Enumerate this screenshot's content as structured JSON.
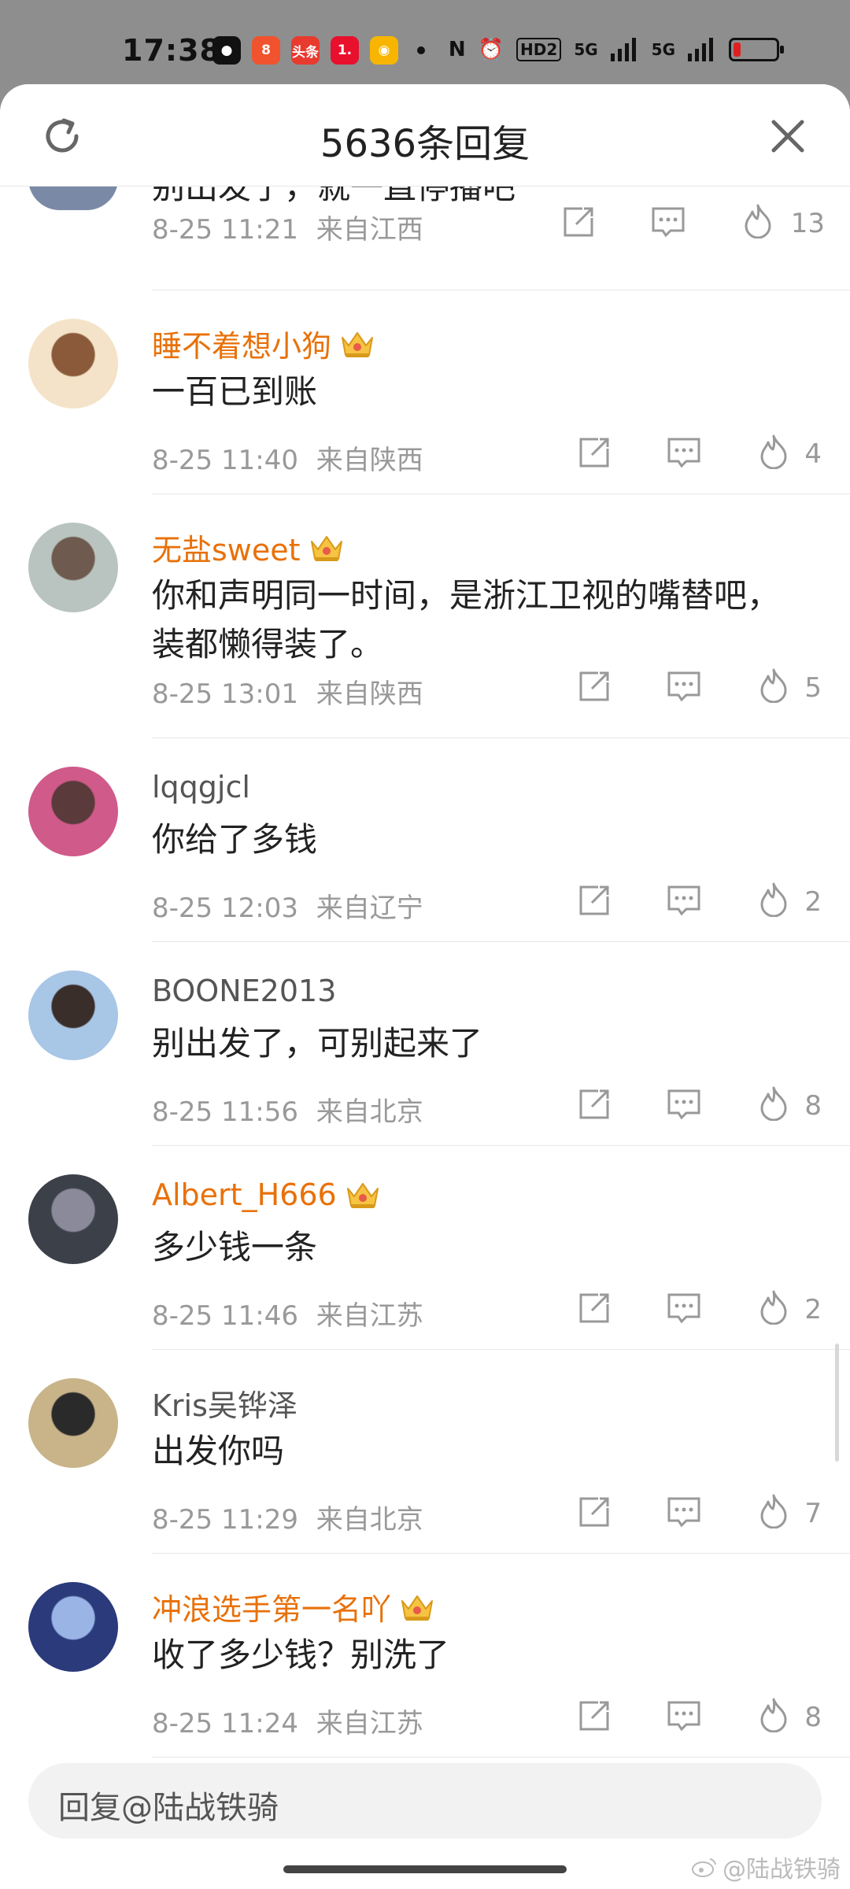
{
  "status_bar": {
    "time": "17:38",
    "apps": [
      {
        "icon": "wechat-icon",
        "color": "#111111",
        "glyph": "●"
      },
      {
        "icon": "app-8-icon",
        "color": "#f0532d",
        "glyph": "8"
      },
      {
        "icon": "toutiao-icon",
        "color": "#e83a2f",
        "glyph": "头条"
      },
      {
        "icon": "app-1-icon",
        "color": "#e8102c",
        "glyph": "1."
      },
      {
        "icon": "weibo-icon",
        "color": "#f7b500",
        "glyph": "◉"
      }
    ],
    "network": [
      "N",
      "⏰",
      "HD2",
      "5G",
      "5G"
    ],
    "battery_level": 0.15
  },
  "header": {
    "title": "5636条回复"
  },
  "partial_comment": {
    "text": "别出发了，就一直停播吧",
    "time": "8-25 11:21",
    "location": "来自江西",
    "likes": "13"
  },
  "comments": [
    {
      "username": "睡不着想小狗",
      "vip": true,
      "text": "一百已到账",
      "time": "8-25 11:40",
      "location": "来自陕西",
      "likes": "4",
      "avatar_colors": [
        "#f4e3c8",
        "#8a5a3a"
      ]
    },
    {
      "username": "无盐sweet",
      "vip": true,
      "text": "你和声明同一时间，是浙江卫视的嘴替吧，装都懒得装了。",
      "time": "8-25 13:01",
      "location": "来自陕西",
      "likes": "5",
      "avatar_colors": [
        "#b9c4c0",
        "#6e5a4e"
      ]
    },
    {
      "username": "lqqgjcl",
      "vip": false,
      "text": "你给了多钱",
      "time": "8-25 12:03",
      "location": "来自辽宁",
      "likes": "2",
      "avatar_colors": [
        "#d05a8a",
        "#5a3a3a"
      ]
    },
    {
      "username": "BOONE2013",
      "vip": false,
      "text": "别出发了，可别起来了",
      "time": "8-25 11:56",
      "location": "来自北京",
      "likes": "8",
      "avatar_colors": [
        "#a8c6e6",
        "#3a2e2a"
      ]
    },
    {
      "username": "Albert_H666",
      "vip": true,
      "text": "多少钱一条",
      "time": "8-25 11:46",
      "location": "来自江苏",
      "likes": "2",
      "avatar_colors": [
        "#3c4048",
        "#8a8a9a"
      ]
    },
    {
      "username": "Kris吴铧泽",
      "vip": false,
      "text": "出发你吗",
      "time": "8-25 11:29",
      "location": "来自北京",
      "likes": "7",
      "avatar_colors": [
        "#c9b48a",
        "#2a2a2a"
      ]
    },
    {
      "username": "冲浪选手第一名吖",
      "vip": true,
      "text": "收了多少钱？别洗了",
      "time": "8-25 11:24",
      "location": "来自江苏",
      "likes": "8",
      "avatar_colors": [
        "#2a3a7a",
        "#9ab4e6"
      ]
    }
  ],
  "reply_bar": {
    "placeholder": "回复@陆战铁骑"
  },
  "watermark": "@陆战铁骑"
}
